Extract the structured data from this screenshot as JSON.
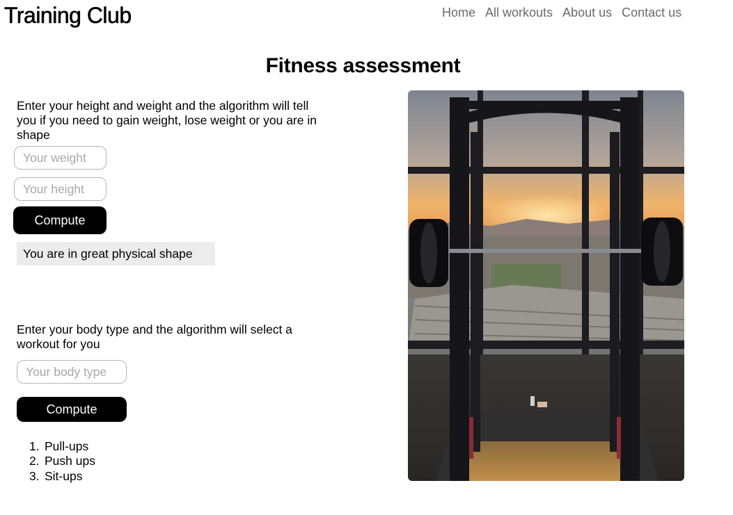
{
  "header": {
    "logo": "Training Club",
    "nav": [
      "Home",
      "All workouts",
      "About us",
      "Contact us"
    ]
  },
  "page_title": "Fitness assessment",
  "assessment": {
    "description": "Enter your height and weight and the algorithm will tell you if you need to gain weight, lose weight or you are in shape",
    "weight_placeholder": "Your weight",
    "height_placeholder": "Your height",
    "compute_label": "Compute",
    "result": "You are in great physical shape"
  },
  "workout": {
    "description": "Enter your body type and the algorithm will select a workout for you",
    "body_type_placeholder": "Your body type",
    "compute_label": "Compute",
    "items": [
      {
        "num": "1.",
        "label": "Pull-ups"
      },
      {
        "num": "2.",
        "label": "Push ups"
      },
      {
        "num": "3.",
        "label": "Sit-ups"
      }
    ]
  },
  "image": {
    "icon": "gym-squat-rack-photo"
  }
}
